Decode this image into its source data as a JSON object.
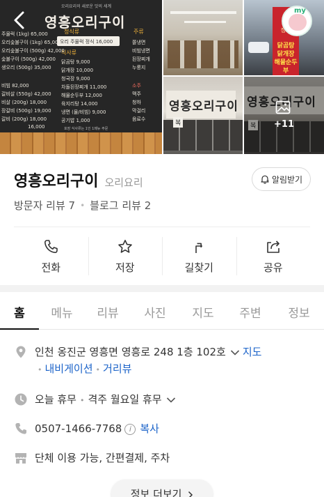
{
  "photos": {
    "menu_board": {
      "title": "영흥오리구이",
      "sub": "오리요리의 새로운 맛의 세계",
      "sections": [
        "정식류",
        "식사류",
        "주류"
      ],
      "lines_left": [
        "주물럭 (1kg)  65,000",
        "오리숯불구이 (1kg)  65,000",
        "오리숯불구이 (500g)  42,000",
        "숯불구이 (500g)  42,000",
        "생오리 (500g)  35,000"
      ],
      "set_menu": "오리 주물럭 정식 16,000",
      "lines_mid": [
        "닭곰탕  9,000",
        "닭개장  10,000",
        "청국장  9,000",
        "차돌된장찌개  11,000",
        "해물순두부  12,000",
        "육지리탕  14,000",
        "냉면 (물/비빔)  9,000",
        "공기밥  1,000"
      ],
      "lines_side": [
        "쫄냉면",
        "비빔냉면",
        "된장찌개",
        "누룽지",
        "소주",
        "맥주",
        "청하",
        "막걸리",
        "음료수"
      ],
      "lines_lower": [
        "비빔  82,000",
        "갈비살 (550g)  42,000",
        "비살 (200g)  18,000",
        "장갈비 (500g)  19,000",
        "갈비 (200g)  18,000",
        "16,000"
      ],
      "footnote": "포장 식사류는 1인 1메뉴 주문",
      "store_sign": "영흥오리구이",
      "shop_sign": "복",
      "banner_top": "정식",
      "banner_lines": [
        "닭곰탕",
        "닭개장",
        "해물순두부"
      ],
      "more_count": "+11"
    },
    "my_label": "my"
  },
  "place": {
    "name": "영흥오리구이",
    "category": "오리요리",
    "notify_label": "알림받기",
    "visitor_reviews": "방문자 리뷰 7",
    "blog_reviews": "블로그 리뷰 2"
  },
  "actions": [
    {
      "label": "전화",
      "icon": "phone-icon"
    },
    {
      "label": "저장",
      "icon": "star-icon"
    },
    {
      "label": "길찾기",
      "icon": "directions-icon"
    },
    {
      "label": "공유",
      "icon": "share-icon"
    }
  ],
  "tabs": [
    "홈",
    "메뉴",
    "리뷰",
    "사진",
    "지도",
    "주변",
    "정보"
  ],
  "active_tab": "홈",
  "info": {
    "address": "인천 옹진군 영흥면 영흥로 248 1층 102호",
    "map_link": "지도",
    "navi_link": "내비게이션",
    "distance_link": "거리뷰",
    "hours_status": "오늘 휴무",
    "hours_detail": "격주 월요일 휴무",
    "phone": "0507-1466-7768",
    "copy_label": "복사",
    "amenities": "단체 이용 가능, 간편결제, 주차",
    "more_button": "정보 더보기"
  },
  "colors": {
    "link": "#1b63c9",
    "accent_green": "#2bb07a"
  }
}
